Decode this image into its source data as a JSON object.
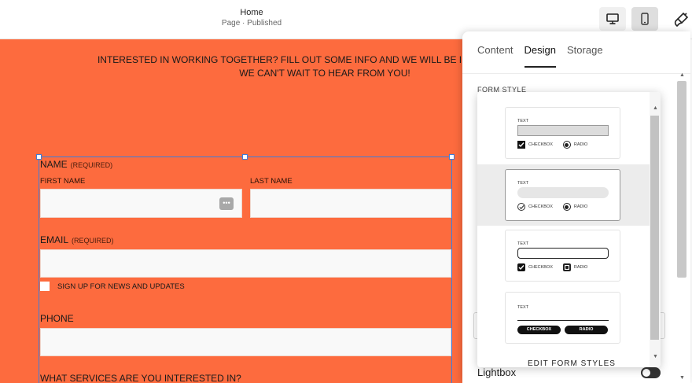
{
  "topbar": {
    "title": "Home",
    "subtitle": "Page · Published",
    "desktop_icon": "desktop-icon",
    "mobile_icon": "mobile-icon",
    "style_icon": "paintbrush-icon"
  },
  "canvas": {
    "intro_line1": "INTERESTED IN WORKING TOGETHER? FILL OUT SOME INFO AND WE WILL BE IN TOUCH SHORTLY.",
    "intro_line2": "WE CAN'T WAIT TO HEAR FROM YOU!",
    "name_label": "NAME",
    "name_required": "(REQUIRED)",
    "first_name_label": "FIRST NAME",
    "last_name_label": "LAST NAME",
    "email_label": "EMAIL",
    "email_required": "(REQUIRED)",
    "newsletter_label": "SIGN UP FOR NEWS AND UPDATES",
    "phone_label": "PHONE",
    "services_label": "WHAT SERVICES ARE YOU INTERESTED IN?",
    "dots_glyph": "•••",
    "background_color": "#fd6b3e"
  },
  "panel": {
    "tabs": [
      {
        "label": "Content",
        "active": false
      },
      {
        "label": "Design",
        "active": true
      },
      {
        "label": "Storage",
        "active": false
      }
    ],
    "section_title": "FORM STYLE",
    "lightbox_label": "Lightbox"
  },
  "dropdown": {
    "options": [
      {
        "text": "TEXT",
        "checkbox": "CHECKBOX",
        "radio": "RADIO",
        "selected": false
      },
      {
        "text": "TEXT",
        "checkbox": "CHECKBOX",
        "radio": "RADIO",
        "selected": true
      },
      {
        "text": "TEXT",
        "checkbox": "CHECKBOX",
        "radio": "RADIO",
        "selected": false
      },
      {
        "text": "TEXT",
        "checkbox": "CHECKBOX",
        "radio": "RADIO",
        "selected": false
      }
    ],
    "footer": "EDIT FORM STYLES"
  },
  "colors": {
    "accent": "#fd6b3e",
    "selection": "#3b7ddd"
  }
}
